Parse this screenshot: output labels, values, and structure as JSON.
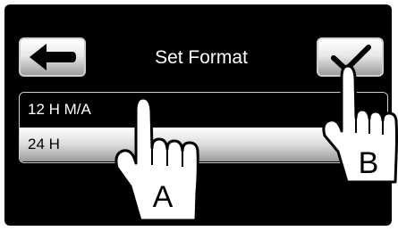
{
  "header": {
    "title": "Set Format"
  },
  "toolbar": {
    "back_icon": "left-arrow-icon",
    "confirm_icon": "checkmark-icon"
  },
  "format_list": {
    "items": [
      {
        "label": "12 H M/A",
        "selected": false
      },
      {
        "label": "24 H",
        "selected": true
      }
    ]
  },
  "callouts": {
    "a_label": "A",
    "b_label": "B"
  },
  "colors": {
    "screen_bg": "#000000",
    "text_light": "#ffffff",
    "button_face": "#e9e9e9"
  }
}
